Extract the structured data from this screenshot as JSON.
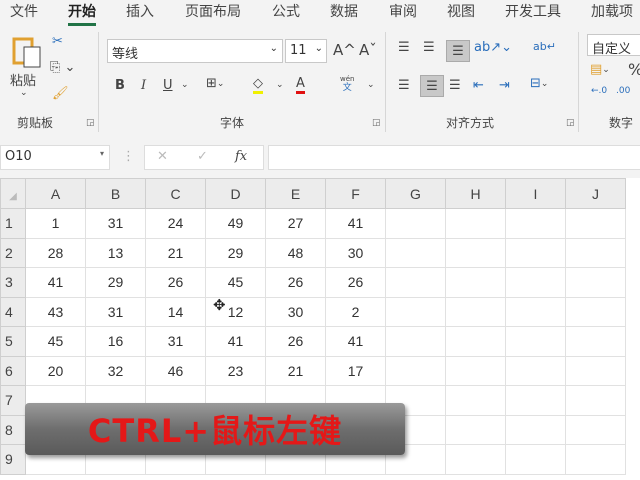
{
  "tabs": [
    "文件",
    "开始",
    "插入",
    "页面布局",
    "公式",
    "数据",
    "审阅",
    "视图",
    "开发工具",
    "加载项"
  ],
  "active_tab": "开始",
  "ribbon": {
    "clipboard": {
      "paste": "粘贴",
      "label": "剪贴板"
    },
    "font": {
      "name": "等线",
      "size": "11",
      "label": "字体",
      "bold": "B",
      "italic": "I",
      "underline": "U",
      "phonetic_top": "wén",
      "phonetic_bottom": "文",
      "grow": "A^",
      "shrink": "Aˇ",
      "font_color": "A"
    },
    "alignment": {
      "label": "对齐方式"
    },
    "number": {
      "format": "自定义",
      "label": "数字",
      "percent": "%"
    }
  },
  "formula_bar": {
    "name_box": "O10",
    "cancel": "✕",
    "enter": "✓",
    "fx": "fx",
    "value": ""
  },
  "sheet": {
    "columns": [
      "A",
      "B",
      "C",
      "D",
      "E",
      "F",
      "G",
      "H",
      "I",
      "J"
    ],
    "rows": [
      {
        "num": "1",
        "cells": [
          "1",
          "31",
          "24",
          "49",
          "27",
          "41"
        ]
      },
      {
        "num": "2",
        "cells": [
          "28",
          "13",
          "21",
          "29",
          "48",
          "30"
        ]
      },
      {
        "num": "3",
        "cells": [
          "41",
          "29",
          "26",
          "45",
          "26",
          "26"
        ]
      },
      {
        "num": "4",
        "cells": [
          "43",
          "31",
          "14",
          "12",
          "30",
          "2"
        ]
      },
      {
        "num": "5",
        "cells": [
          "45",
          "16",
          "31",
          "41",
          "26",
          "41"
        ]
      },
      {
        "num": "6",
        "cells": [
          "20",
          "32",
          "46",
          "23",
          "21",
          "17"
        ]
      },
      {
        "num": "7",
        "cells": []
      },
      {
        "num": "8",
        "cells": []
      },
      {
        "num": "9",
        "cells": []
      }
    ]
  },
  "overlay": {
    "text": "CTRL+鼠标左键",
    "color": "#e41818"
  }
}
